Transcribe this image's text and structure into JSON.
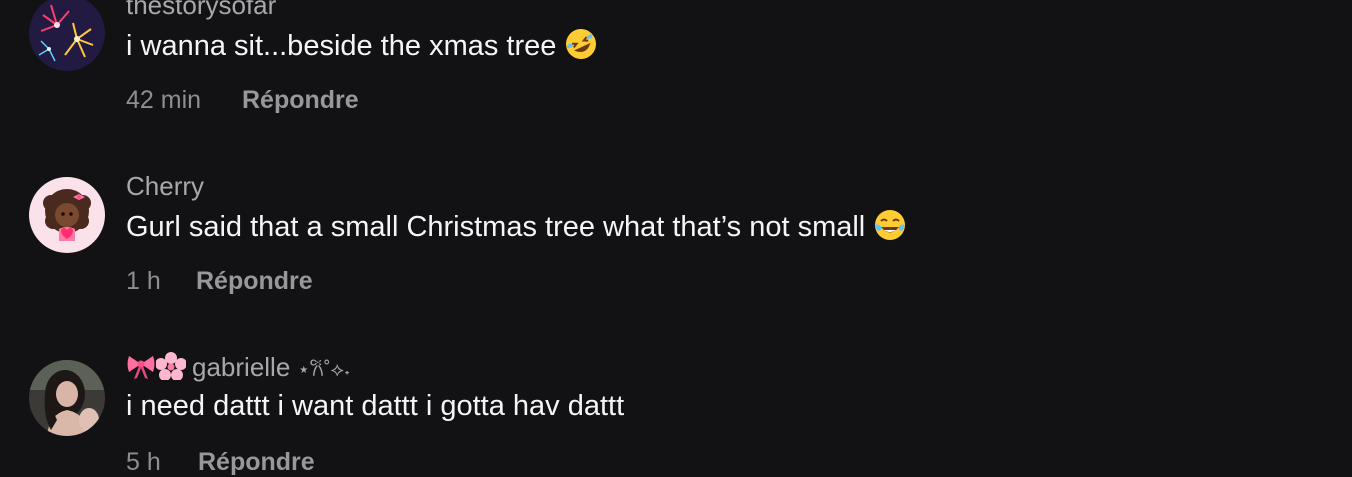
{
  "comments": [
    {
      "username": "thestorysofar",
      "text": "i wanna sit...beside the xmas tree",
      "emoji": "rolling-on-floor-laughing-emoji",
      "time": "42 min",
      "reply_label": "Répondre"
    },
    {
      "username": "Cherry",
      "text": "Gurl said that a small Christmas tree what that’s not small",
      "emoji": "tears-of-joy-emoji",
      "time": "1 h",
      "reply_label": "Répondre"
    },
    {
      "username_prefix_icons": [
        "ribbon-icon",
        "cherry-blossom-icon"
      ],
      "username": "gabrielle",
      "username_suffix": "⋆𐙚˚⟡˖",
      "text": "i need dattt i want dattt i gotta hav dattt",
      "time": "5 h",
      "reply_label": "Répondre"
    }
  ]
}
